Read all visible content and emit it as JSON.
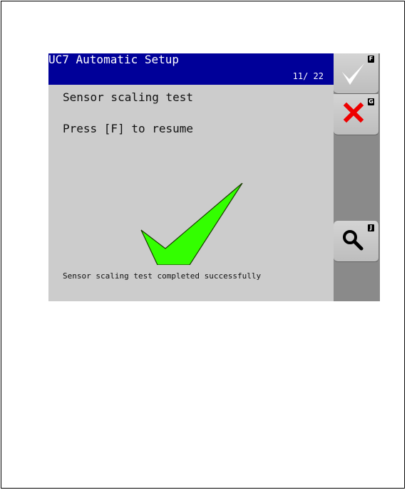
{
  "screen": {
    "title": "UC7 Automatic Setup",
    "page_indicator": "11/ 22"
  },
  "content": {
    "line1": "Sensor scaling test",
    "line2": "Press [F] to resume",
    "status": "Sensor scaling test completed successfully",
    "big_icon": "check-icon",
    "big_icon_color": "#33ff00"
  },
  "softkeys": [
    {
      "key": "F",
      "icon": "check-icon"
    },
    {
      "key": "G",
      "icon": "cross-icon"
    },
    {
      "key": "J",
      "icon": "magnifier-icon"
    }
  ],
  "colors": {
    "titlebar": "#000099",
    "background": "#cccccc",
    "sidebar": "#8a8a8a",
    "cross": "#ee0000"
  }
}
